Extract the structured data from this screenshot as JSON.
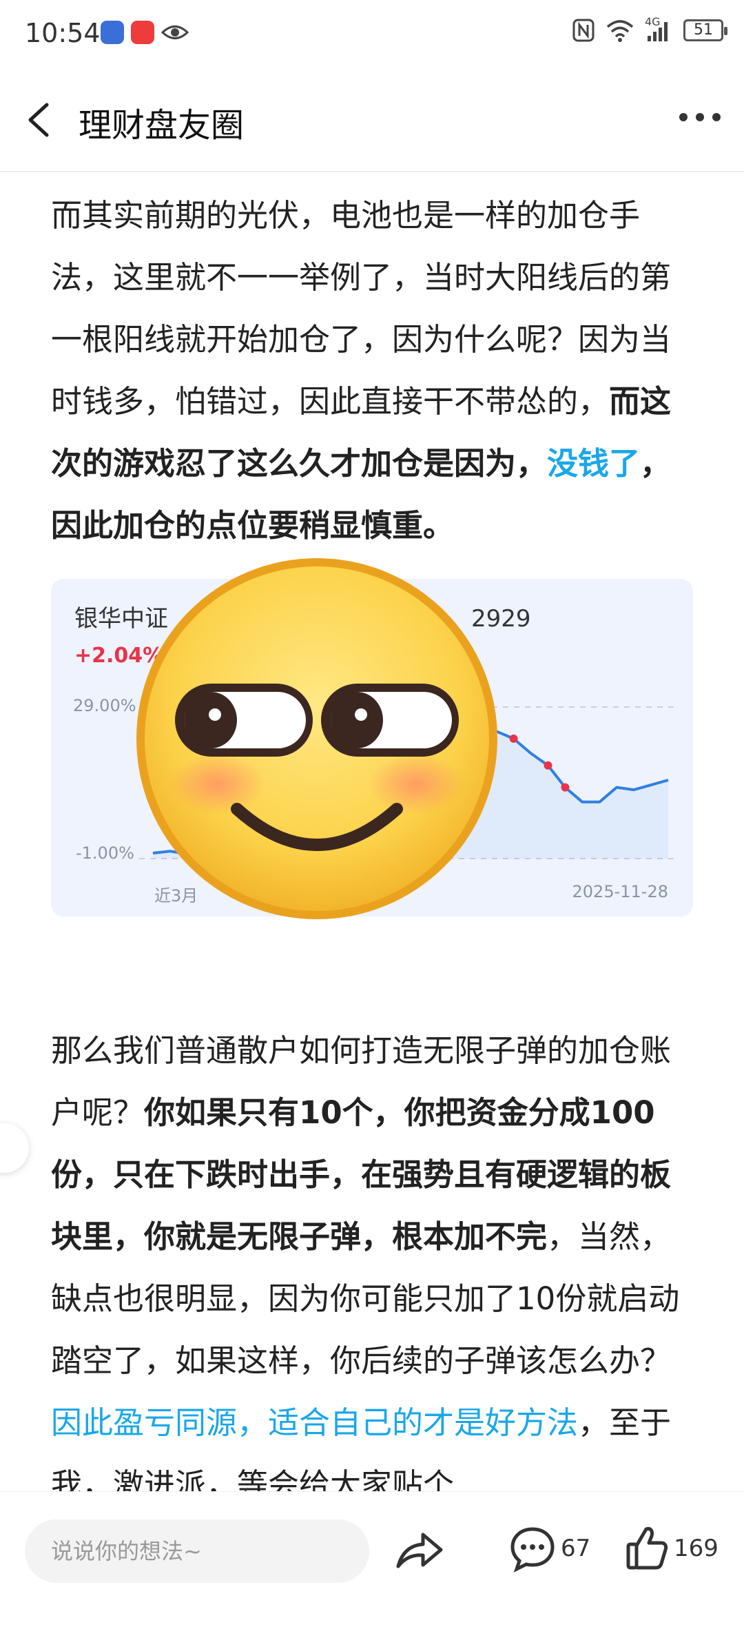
{
  "status_bar": {
    "time": "10:54",
    "network": "4G",
    "battery": "51"
  },
  "header": {
    "title": "理财盘友圈"
  },
  "article": {
    "p1": {
      "t1": "而其实前期的光伏，电池也是一样的加仓手法，这里就不一一举例了，当时大阳线后的第一根阳线就开始加仓了，因为什么呢？因为当时钱多，怕错过，因此直接干不带怂的，",
      "t2": "而这次的游戏忍了这么久才加仓是因为，",
      "t3": "没钱了",
      "t4": "，因此加仓的点位要稍显慎重。"
    },
    "p2": {
      "t1": "那么我们普通散户如何打造无限子弹的加仓账户呢？",
      "t2": "你如果只有10个，你把资金分成100份，只在下跌时出手，在强势且有硬逻辑的板块里，你就是无限子弹，根本加不完",
      "t3": "，当然，缺点也很明显，因为你可能只加了10份就启动踏空了，如果这样，你后续的子弹该怎么办？",
      "t4": "因此盈亏同源，适合自己的才是好方法",
      "t5": "，至于我，激进派，等会给大家贴个"
    }
  },
  "chart_card": {
    "title_left": "银华中证",
    "title_right": "2929",
    "change": "+2.04%",
    "accent": "#2f7fe3",
    "marker_color": "#e8334a"
  },
  "chart_data": {
    "type": "line",
    "ytick_labels": [
      "29.00%",
      "-1.00%"
    ],
    "ylim": [
      -1.0,
      29.0
    ],
    "xtick_labels": [
      "近3月",
      "2025-11-28"
    ],
    "series": [
      {
        "values": [
          -1.0,
          -0.6,
          -1.2,
          2.0,
          5.0,
          8.0,
          10.5,
          12.0,
          11.0,
          14.0,
          17.0,
          20.5,
          23.0,
          24.5,
          22.0,
          24.0,
          27.0,
          29.0,
          28.5,
          26.0,
          24.0,
          22.5,
          19.5,
          17.0,
          12.5,
          9.5,
          9.5,
          12.5,
          12.0,
          13.0,
          14.0
        ]
      }
    ],
    "markers": [
      21,
      23,
      24
    ]
  },
  "emoji": {
    "name": "smirk-emoji"
  },
  "bottom_bar": {
    "input_placeholder": "说说你的想法~",
    "comment_count": "67",
    "like_count": "169"
  }
}
